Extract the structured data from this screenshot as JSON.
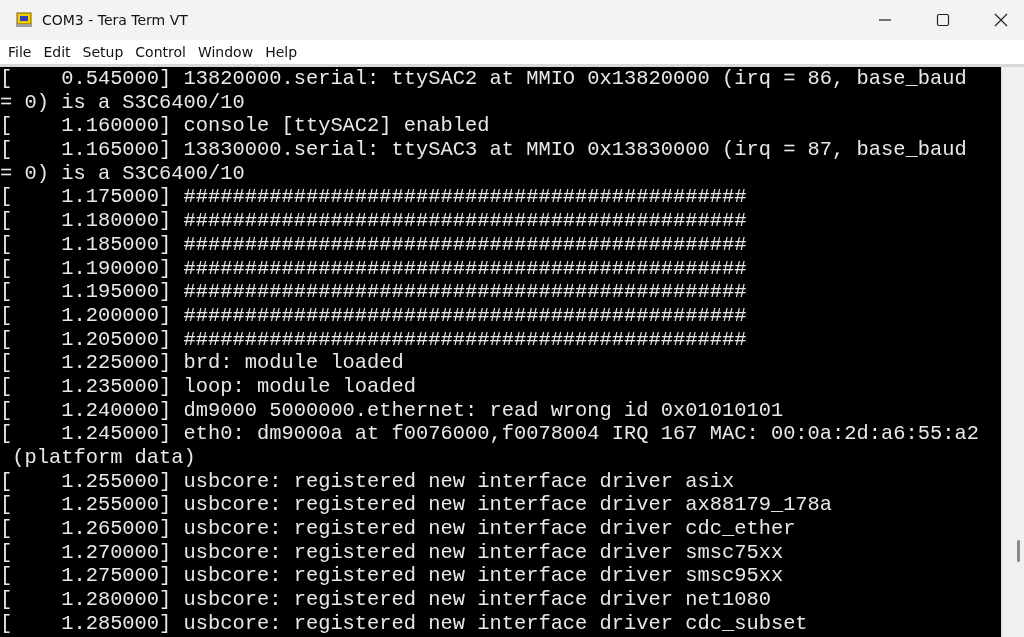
{
  "window": {
    "title": "COM3 - Tera Term VT"
  },
  "menu": [
    "File",
    "Edit",
    "Setup",
    "Control",
    "Window",
    "Help"
  ],
  "terminal": {
    "lines": [
      "[    0.545000] 13820000.serial: ttySAC2 at MMIO 0x13820000 (irq = 86, base_baud",
      "= 0) is a S3C6400/10",
      "[    1.160000] console [ttySAC2] enabled",
      "[    1.165000] 13830000.serial: ttySAC3 at MMIO 0x13830000 (irq = 87, base_baud",
      "= 0) is a S3C6400/10",
      "[    1.175000] ##############################################",
      "[    1.180000] ##############################################",
      "[    1.185000] ##############################################",
      "[    1.190000] ##############################################",
      "[    1.195000] ##############################################",
      "[    1.200000] ##############################################",
      "[    1.205000] ##############################################",
      "[    1.225000] brd: module loaded",
      "[    1.235000] loop: module loaded",
      "[    1.240000] dm9000 5000000.ethernet: read wrong id 0x01010101",
      "[    1.245000] eth0: dm9000a at f0076000,f0078004 IRQ 167 MAC: 00:0a:2d:a6:55:a2",
      " (platform data)",
      "[    1.255000] usbcore: registered new interface driver asix",
      "[    1.255000] usbcore: registered new interface driver ax88179_178a",
      "[    1.265000] usbcore: registered new interface driver cdc_ether",
      "[    1.270000] usbcore: registered new interface driver smsc75xx",
      "[    1.275000] usbcore: registered new interface driver smsc95xx",
      "[    1.280000] usbcore: registered new interface driver net1080",
      "[    1.285000] usbcore: registered new interface driver cdc_subset"
    ]
  }
}
